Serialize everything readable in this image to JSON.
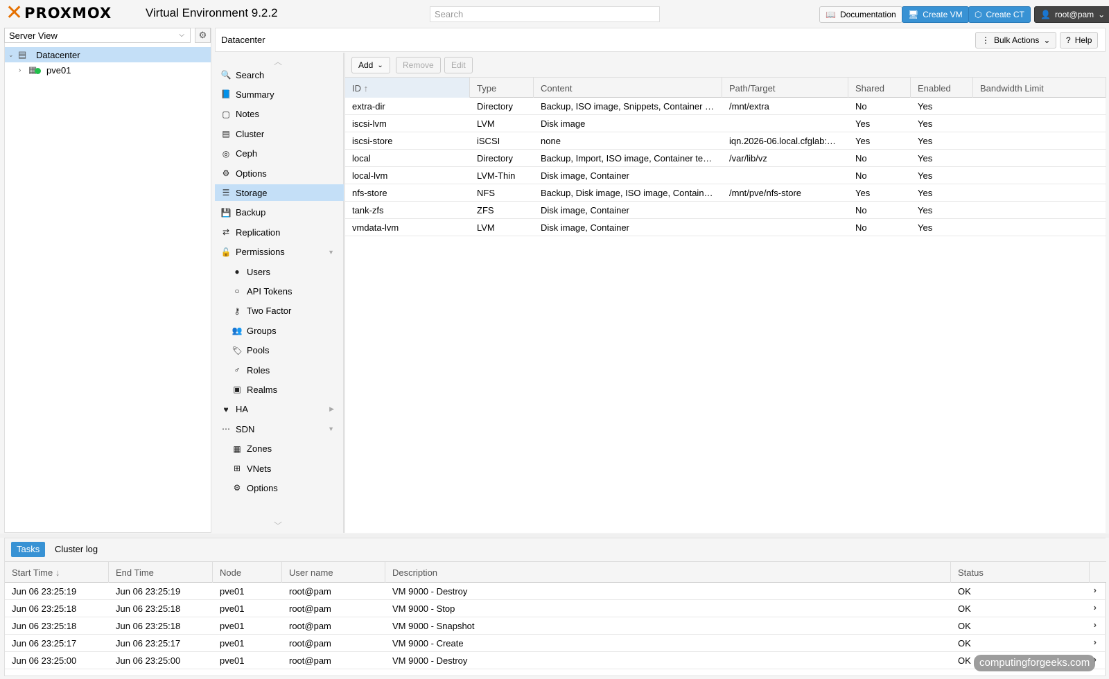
{
  "header": {
    "brand": "PROXMOX",
    "version": "Virtual Environment 9.2.2",
    "search_placeholder": "Search",
    "documentation": "Documentation",
    "create_vm": "Create VM",
    "create_ct": "Create CT",
    "user": "root@pam"
  },
  "tree": {
    "view": "Server View",
    "datacenter": "Datacenter",
    "node": "pve01"
  },
  "content": {
    "title": "Datacenter",
    "bulk_actions": "Bulk Actions",
    "help": "Help"
  },
  "menu": {
    "items": [
      {
        "label": "Search",
        "icon": "search-icon"
      },
      {
        "label": "Summary",
        "icon": "book-icon"
      },
      {
        "label": "Notes",
        "icon": "note-icon"
      },
      {
        "label": "Cluster",
        "icon": "server-icon"
      },
      {
        "label": "Ceph",
        "icon": "ceph-icon"
      },
      {
        "label": "Options",
        "icon": "gear-icon"
      },
      {
        "label": "Storage",
        "icon": "database-icon",
        "selected": true
      },
      {
        "label": "Backup",
        "icon": "floppy-icon"
      },
      {
        "label": "Replication",
        "icon": "retweet-icon"
      },
      {
        "label": "Permissions",
        "icon": "unlock-icon",
        "expandable": "down"
      },
      {
        "label": "Users",
        "icon": "user-icon",
        "child": true
      },
      {
        "label": "API Tokens",
        "icon": "user-outline-icon",
        "child": true
      },
      {
        "label": "Two Factor",
        "icon": "key-icon",
        "child": true
      },
      {
        "label": "Groups",
        "icon": "users-icon",
        "child": true
      },
      {
        "label": "Pools",
        "icon": "tags-icon",
        "child": true
      },
      {
        "label": "Roles",
        "icon": "male-icon",
        "child": true
      },
      {
        "label": "Realms",
        "icon": "address-book-icon",
        "child": true
      },
      {
        "label": "HA",
        "icon": "heartbeat-icon",
        "expandable": "right"
      },
      {
        "label": "SDN",
        "icon": "network-icon",
        "expandable": "down"
      },
      {
        "label": "Zones",
        "icon": "grid-icon",
        "child": true
      },
      {
        "label": "VNets",
        "icon": "sitemap-icon",
        "child": true
      },
      {
        "label": "Options",
        "icon": "gear-icon",
        "child": true
      }
    ]
  },
  "storage": {
    "toolbar": {
      "add": "Add",
      "remove": "Remove",
      "edit": "Edit"
    },
    "columns": [
      "ID",
      "Type",
      "Content",
      "Path/Target",
      "Shared",
      "Enabled",
      "Bandwidth Limit"
    ],
    "rows": [
      [
        "extra-dir",
        "Directory",
        "Backup, ISO image, Snippets, Container …",
        "/mnt/extra",
        "No",
        "Yes",
        ""
      ],
      [
        "iscsi-lvm",
        "LVM",
        "Disk image",
        "",
        "Yes",
        "Yes",
        ""
      ],
      [
        "iscsi-store",
        "iSCSI",
        "none",
        "iqn.2026-06.local.cfglab:…",
        "Yes",
        "Yes",
        ""
      ],
      [
        "local",
        "Directory",
        "Backup, Import, ISO image, Container te…",
        "/var/lib/vz",
        "No",
        "Yes",
        ""
      ],
      [
        "local-lvm",
        "LVM-Thin",
        "Disk image, Container",
        "",
        "No",
        "Yes",
        ""
      ],
      [
        "nfs-store",
        "NFS",
        "Backup, Disk image, ISO image, Contain…",
        "/mnt/pve/nfs-store",
        "Yes",
        "Yes",
        ""
      ],
      [
        "tank-zfs",
        "ZFS",
        "Disk image, Container",
        "",
        "No",
        "Yes",
        ""
      ],
      [
        "vmdata-lvm",
        "LVM",
        "Disk image, Container",
        "",
        "No",
        "Yes",
        ""
      ]
    ]
  },
  "tasks": {
    "tabs": [
      "Tasks",
      "Cluster log"
    ],
    "columns": [
      "Start Time",
      "End Time",
      "Node",
      "User name",
      "Description",
      "Status"
    ],
    "rows": [
      [
        "Jun 06 23:25:19",
        "Jun 06 23:25:19",
        "pve01",
        "root@pam",
        "VM 9000 - Destroy",
        "OK"
      ],
      [
        "Jun 06 23:25:18",
        "Jun 06 23:25:18",
        "pve01",
        "root@pam",
        "VM 9000 - Stop",
        "OK"
      ],
      [
        "Jun 06 23:25:18",
        "Jun 06 23:25:18",
        "pve01",
        "root@pam",
        "VM 9000 - Snapshot",
        "OK"
      ],
      [
        "Jun 06 23:25:17",
        "Jun 06 23:25:17",
        "pve01",
        "root@pam",
        "VM 9000 - Create",
        "OK"
      ],
      [
        "Jun 06 23:25:00",
        "Jun 06 23:25:00",
        "pve01",
        "root@pam",
        "VM 9000 - Destroy",
        "OK"
      ]
    ]
  },
  "watermark": "computingforgeeks.com",
  "colors": {
    "accent": "#3892d4",
    "brand": "#e57000",
    "selection": "#c4dff7"
  }
}
